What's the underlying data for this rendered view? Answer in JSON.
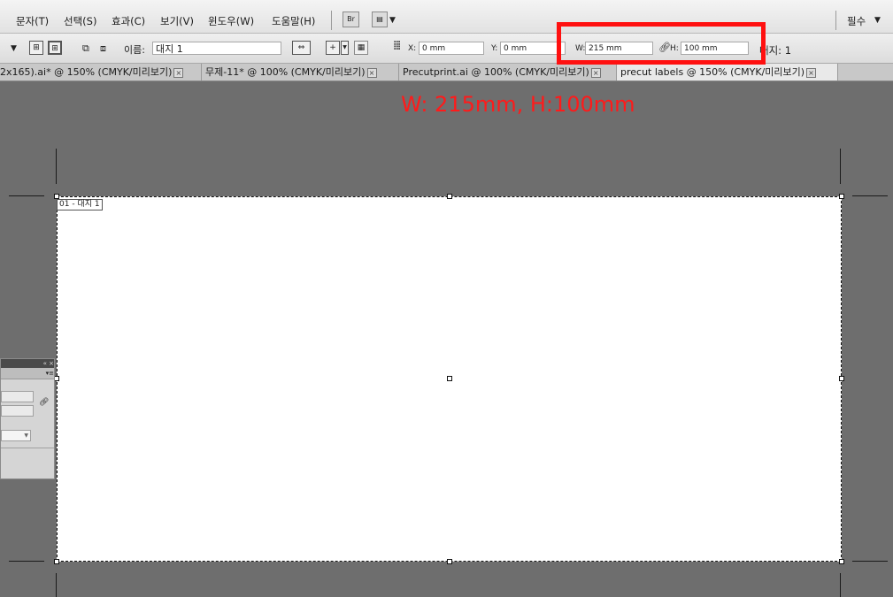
{
  "menu": {
    "items": [
      "문자(T)",
      "선택(S)",
      "효과(C)",
      "보기(V)",
      "윈도우(W)",
      "도움말(H)"
    ],
    "bridge_label": "Br",
    "workspace_label": "필수"
  },
  "control": {
    "name_label": "이름:",
    "name_value": "대지 1",
    "x_label": "X:",
    "x_value": "0 mm",
    "y_label": "Y:",
    "y_value": "0 mm",
    "w_label": "W:",
    "w_value": "215 mm",
    "h_label": "H:",
    "h_value": "100 mm",
    "artboard_count": "대지: 1"
  },
  "tabs": [
    {
      "label": "2x165).ai* @ 150% (CMYK/미리보기)",
      "active": false
    },
    {
      "label": "무제-11* @ 100% (CMYK/미리보기)",
      "active": false
    },
    {
      "label": "Precutprint.ai @ 100% (CMYK/미리보기)",
      "active": false
    },
    {
      "label": "precut labels @ 150% (CMYK/미리보기)",
      "active": true
    }
  ],
  "annotation": "W: 215mm, H:100mm",
  "artboard": {
    "label": "01 - 대지 1"
  },
  "colors": {
    "highlight": "#ff1010",
    "canvas": "#6e6e6e",
    "annotation_text": "#ff1a1a"
  }
}
